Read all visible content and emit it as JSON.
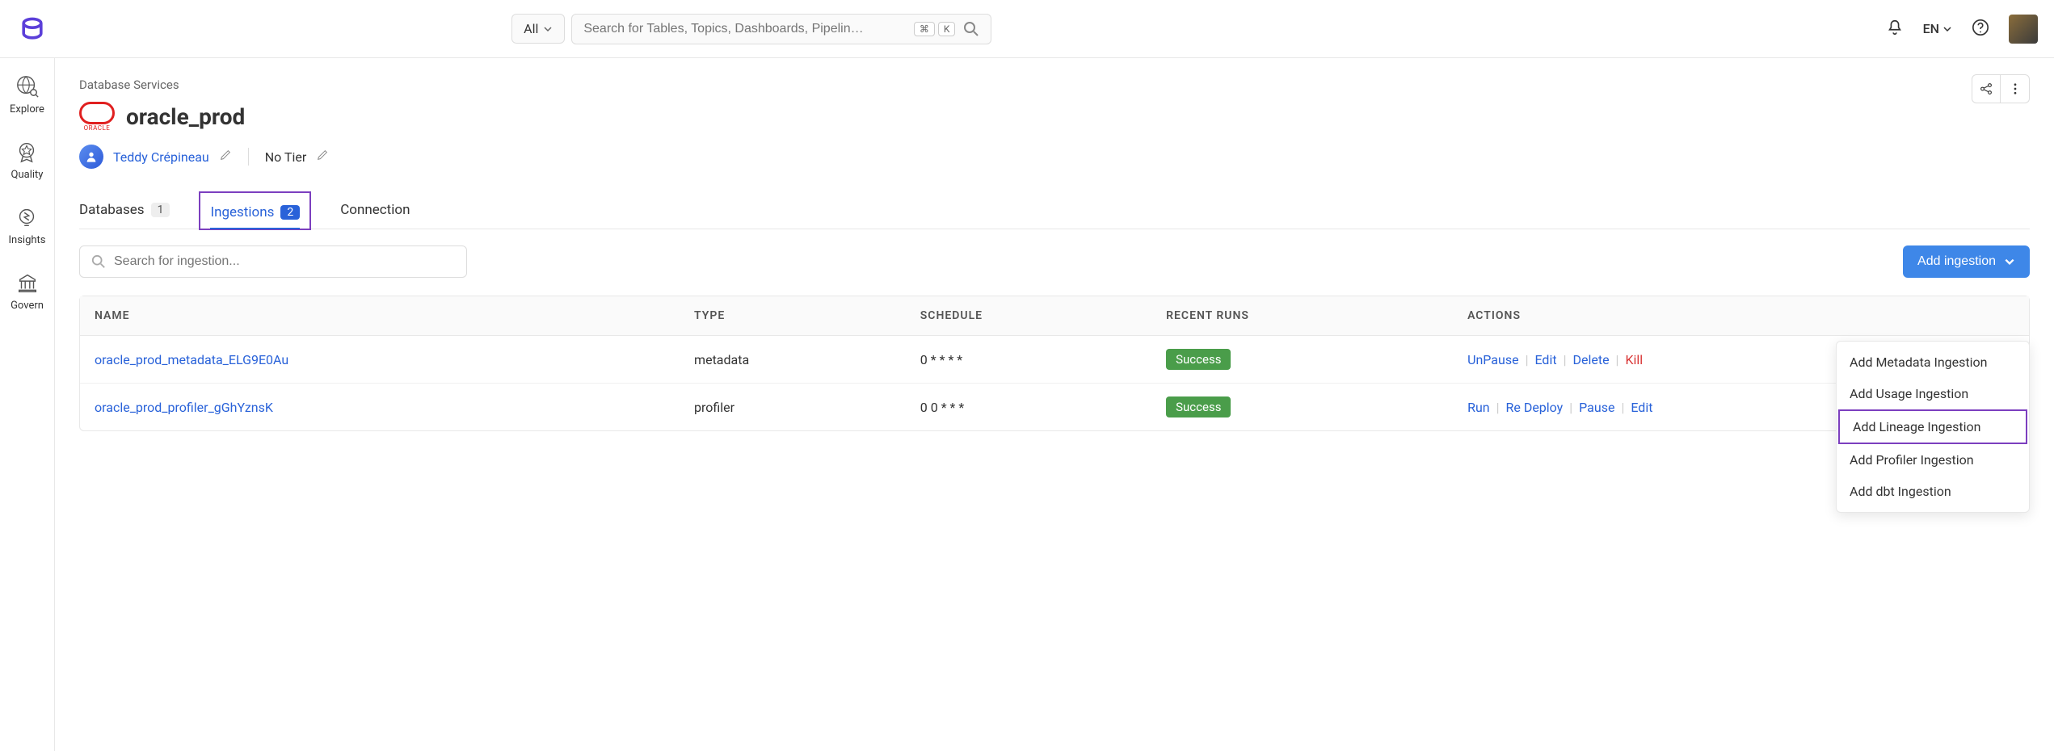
{
  "topbar": {
    "search_all_label": "All",
    "search_placeholder": "Search for Tables, Topics, Dashboards, Pipelin…",
    "kbd1": "⌘",
    "kbd2": "K",
    "language": "EN"
  },
  "sidebar": {
    "items": [
      {
        "label": "Explore"
      },
      {
        "label": "Quality"
      },
      {
        "label": "Insights"
      },
      {
        "label": "Govern"
      }
    ]
  },
  "breadcrumb": "Database Services",
  "service": {
    "name": "oracle_prod",
    "oracle_label": "ORACLE",
    "owner": "Teddy Crépineau",
    "tier": "No Tier"
  },
  "tabs": [
    {
      "label": "Databases",
      "count": "1"
    },
    {
      "label": "Ingestions",
      "count": "2"
    },
    {
      "label": "Connection",
      "count": ""
    }
  ],
  "ingestion": {
    "search_placeholder": "Search for ingestion...",
    "add_button": "Add ingestion",
    "dropdown": [
      "Add Metadata Ingestion",
      "Add Usage Ingestion",
      "Add Lineage Ingestion",
      "Add Profiler Ingestion",
      "Add dbt Ingestion"
    ],
    "columns": [
      "NAME",
      "TYPE",
      "SCHEDULE",
      "RECENT RUNS",
      "ACTIONS"
    ],
    "rows": [
      {
        "name": "oracle_prod_metadata_ELG9E0Au",
        "type": "metadata",
        "schedule": "0 * * * *",
        "status": "Success",
        "action0": "UnPause",
        "action1": "Edit",
        "action2": "Delete",
        "action3": "Kill"
      },
      {
        "name": "oracle_prod_profiler_gGhYznsK",
        "type": "profiler",
        "schedule": "0 0 * * *",
        "status": "Success",
        "action0": "Run",
        "action1": "Re Deploy",
        "action2": "Pause",
        "action3": "Edit"
      }
    ]
  }
}
